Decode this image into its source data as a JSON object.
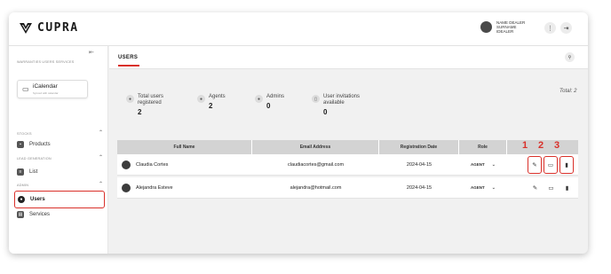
{
  "header": {
    "brand": "CUPRA",
    "user": {
      "line1": "NAME DEALER",
      "line2": "SURNAME",
      "line3": "IDEALER"
    },
    "menu_icon": "more-vertical-icon",
    "logout_icon": "logout-icon"
  },
  "sidebar": {
    "caption_top": "WARRANTIES USERS SERVICES",
    "calendar": {
      "title": "iCalendar",
      "subtitle": "Synced with calendar"
    },
    "sections": [
      {
        "caption": "STOCKS",
        "items": [
          {
            "label": "Products",
            "icon": "car-icon"
          }
        ]
      },
      {
        "caption": "LEAD GENERATION",
        "items": [
          {
            "label": "List",
            "icon": "list-icon"
          }
        ]
      },
      {
        "caption": "ADMIN",
        "items": [
          {
            "label": "Users",
            "icon": "users-icon",
            "active": true
          },
          {
            "label": "Services",
            "icon": "services-icon"
          }
        ]
      }
    ]
  },
  "main": {
    "title": "USERS",
    "total": "Total: 2",
    "stats": [
      {
        "label1": "Total users",
        "label2": "registered",
        "value": "2",
        "icon": "user-icon"
      },
      {
        "label1": "Agents",
        "label2": "",
        "value": "2",
        "icon": "agent-icon"
      },
      {
        "label1": "Admins",
        "label2": "",
        "value": "0",
        "icon": "admin-icon"
      },
      {
        "label1": "User invitations",
        "label2": "available",
        "value": "0",
        "icon": "invitation-icon"
      }
    ],
    "table": {
      "headers": [
        "Full Name",
        "Email Address",
        "Registration Date",
        "Role"
      ],
      "rows": [
        {
          "name": "Claudia Cortes",
          "email": "claudiacortes@gmail.com",
          "date": "2024-04-15",
          "role": "AGENT"
        },
        {
          "name": "Alejandra Esteve",
          "email": "alejandra@hotmail.com",
          "date": "2024-04-15",
          "role": "AGENT"
        }
      ]
    },
    "markers": [
      "1",
      "2",
      "3"
    ]
  },
  "colors": {
    "accent": "#d9302a",
    "table_header": "#d3d3d3",
    "background": "#f1f1f1"
  }
}
